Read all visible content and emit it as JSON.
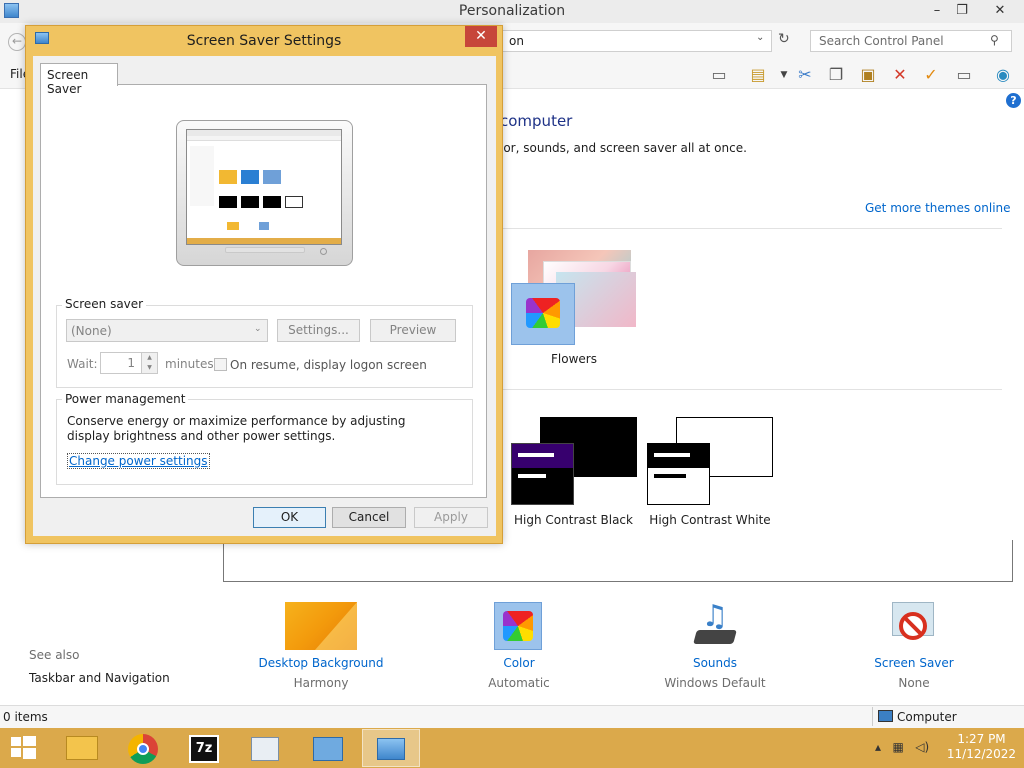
{
  "window": {
    "title": "Personalization",
    "controls": {
      "minimize": "–",
      "maximize": "❐",
      "close": "✕"
    }
  },
  "address": {
    "back": "←",
    "path_tail": "on",
    "search_placeholder": "Search Control Panel"
  },
  "menu": {
    "file": "File"
  },
  "main": {
    "heading_tail": "computer",
    "subheading_tail": "lor, sounds, and screen saver all at once.",
    "get_more_themes": "Get more themes online",
    "themes": [
      {
        "label": "Flowers"
      },
      {
        "label": "High Contrast Black"
      },
      {
        "label": "High Contrast White"
      }
    ]
  },
  "see_also": {
    "label": "See also",
    "items": [
      "Taskbar and Navigation"
    ]
  },
  "bottom_items": [
    {
      "name": "Desktop Background",
      "value": "Harmony",
      "icon": "desktop-background-icon"
    },
    {
      "name": "Color",
      "value": "Automatic",
      "icon": "color-icon"
    },
    {
      "name": "Sounds",
      "value": "Windows Default",
      "icon": "sounds-icon"
    },
    {
      "name": "Screen Saver",
      "value": "None",
      "icon": "screen-saver-icon"
    }
  ],
  "status": {
    "items": "0 items",
    "location": "Computer"
  },
  "dialog": {
    "title": "Screen Saver Settings",
    "close": "✕",
    "tab": "Screen Saver",
    "screen_saver_group": "Screen saver",
    "selected_saver": "(None)",
    "settings_button": "Settings...",
    "preview_button": "Preview",
    "wait_label": "Wait:",
    "wait_value": "1",
    "minutes_label": "minutes",
    "resume_label": "On resume, display logon screen",
    "power_group": "Power management",
    "power_description": "Conserve energy or maximize performance by adjusting display brightness and other power settings.",
    "power_link": "Change power settings",
    "ok": "OK",
    "cancel": "Cancel",
    "apply": "Apply"
  },
  "taskbar": {
    "time": "1:27 PM",
    "date": "11/12/2022",
    "apps": [
      "file-explorer",
      "chrome",
      "7-zip",
      "remote-desktop",
      "control-panel-network",
      "personalization"
    ]
  }
}
